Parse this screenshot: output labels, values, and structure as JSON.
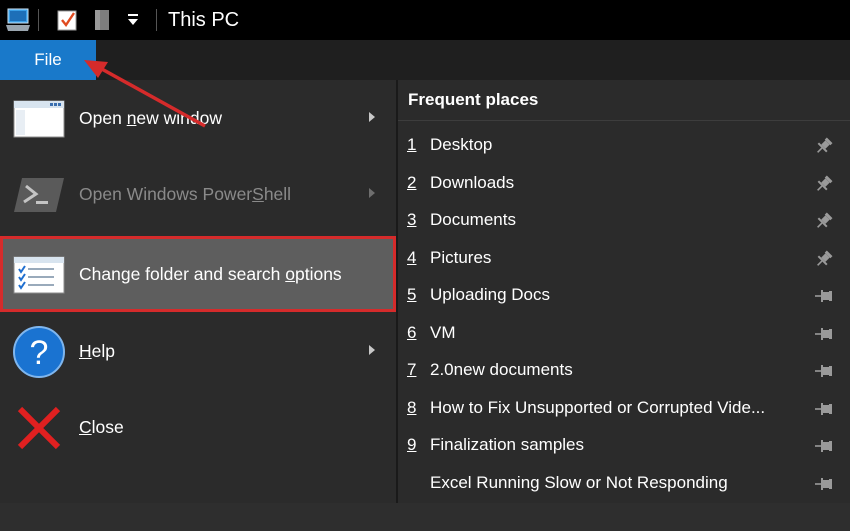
{
  "window": {
    "title": "This PC"
  },
  "ribbon": {
    "file_tab": "File"
  },
  "file_menu": {
    "items": [
      {
        "name": "open-new-window",
        "before": "Open ",
        "accel": "n",
        "after": "ew window",
        "has_submenu": true,
        "disabled": false,
        "highlighted": false
      },
      {
        "name": "open-windows-powershell",
        "before": "Open Windows Power",
        "accel": "S",
        "after": "hell",
        "has_submenu": true,
        "disabled": true,
        "highlighted": false
      },
      {
        "name": "change-folder-and-search-options",
        "before": "Change folder and search ",
        "accel": "o",
        "after": "ptions",
        "has_submenu": false,
        "disabled": false,
        "highlighted": true
      },
      {
        "name": "help",
        "before": "",
        "accel": "H",
        "after": "elp",
        "has_submenu": true,
        "disabled": false,
        "highlighted": false
      },
      {
        "name": "close",
        "before": "",
        "accel": "C",
        "after": "lose",
        "has_submenu": false,
        "disabled": false,
        "highlighted": false
      }
    ]
  },
  "frequent_places": {
    "title": "Frequent places",
    "items": [
      {
        "num": "1",
        "name": "Desktop",
        "pinned": true
      },
      {
        "num": "2",
        "name": "Downloads",
        "pinned": true
      },
      {
        "num": "3",
        "name": "Documents",
        "pinned": true
      },
      {
        "num": "4",
        "name": "Pictures",
        "pinned": true
      },
      {
        "num": "5",
        "name": "Uploading Docs",
        "pinned": false
      },
      {
        "num": "6",
        "name": "VM",
        "pinned": false
      },
      {
        "num": "7",
        "name": "2.0new documents",
        "pinned": false
      },
      {
        "num": "8",
        "name": "How to Fix Unsupported or Corrupted Vide...",
        "pinned": false
      },
      {
        "num": "9",
        "name": "Finalization samples",
        "pinned": false
      },
      {
        "num": "",
        "name": "Excel Running Slow or Not Responding",
        "pinned": false
      }
    ]
  },
  "colors": {
    "file_tab": "#1979ca",
    "highlight_outline": "#d52b2b",
    "annotation_arrow": "#d52b2b"
  }
}
